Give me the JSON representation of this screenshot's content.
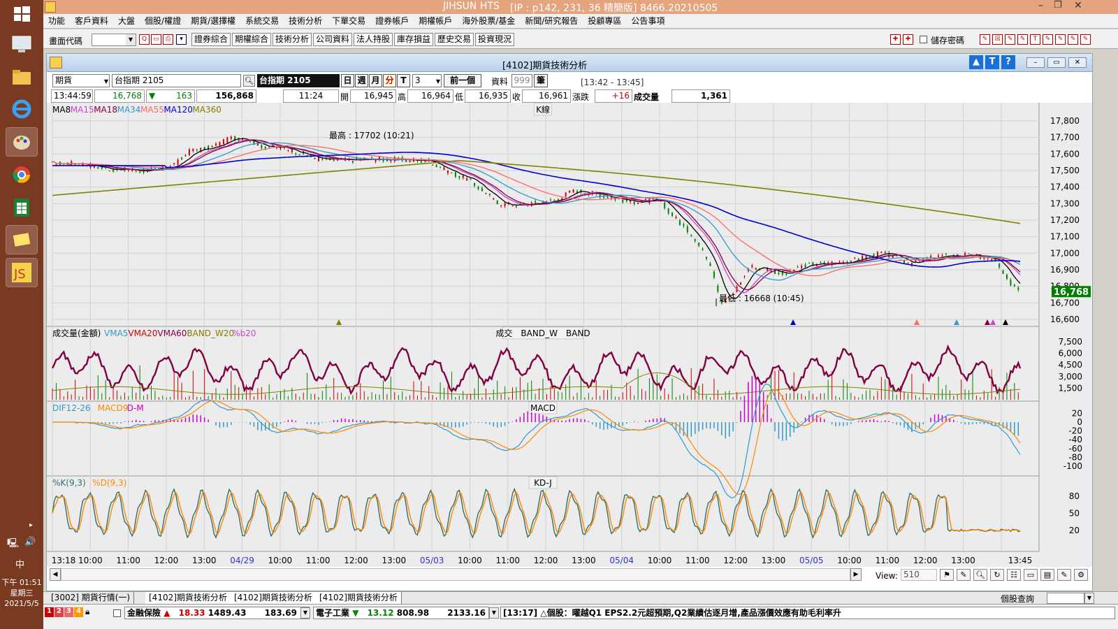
{
  "taskbar": {
    "time": "下午 01:51",
    "weekday": "星期三",
    "date": "2021/5/5",
    "ime": "中"
  },
  "app": {
    "title": "JIHSUN HTS",
    "subtitle": "[IP : p142, 231, 36 精簡版] 8466.20210505"
  },
  "menu": [
    "功能",
    "客戶資料",
    "大盤",
    "個股/權證",
    "期貨/選擇權",
    "系統交易",
    "技術分析",
    "下單交易",
    "證券帳戶",
    "期權帳戶",
    "海外股票/基金",
    "新聞/研究報告",
    "投顧專區",
    "公告事項"
  ],
  "toolbar": {
    "code_label": "畫面代碼",
    "buttons": [
      "證券綜合",
      "期權綜合",
      "技術分析",
      "公司資料",
      "法人持股",
      "庫存損益",
      "歷史交易",
      "投資現況"
    ],
    "save_pwd": "儲存密碼"
  },
  "window": {
    "title": "[4102]期貨技術分析",
    "category": "期貨",
    "contract": "台指期 2105",
    "contract_display": "台指期 2105",
    "periods": [
      "日",
      "週",
      "月",
      "分",
      "T"
    ],
    "minutes": "3",
    "prev_btn": "前一個",
    "data_label": "資料",
    "data_count": "999",
    "data_unit": "筆",
    "time_range": "[13:42 - 13:45]"
  },
  "quote": {
    "time": "13:44:59",
    "price": "16,768",
    "change": "163",
    "volume_total": "156,868",
    "bar_time": "11:24",
    "open_label": "開",
    "open": "16,945",
    "high_label": "高",
    "high": "16,964",
    "low_label": "低",
    "low": "16,935",
    "close_label": "收",
    "close": "16,961",
    "chg_label": "漲跌",
    "chg": "+16",
    "vol_label": "成交量",
    "vol": "1,361"
  },
  "panels": {
    "k": {
      "title": "K線",
      "legend": [
        {
          "name": "MA8",
          "color": "#000000"
        },
        {
          "name": "MA15",
          "color": "#cc44cc"
        },
        {
          "name": "MA18",
          "color": "#800040"
        },
        {
          "name": "MA34",
          "color": "#3399cc"
        },
        {
          "name": "MA55",
          "color": "#ff6666"
        },
        {
          "name": "MA120",
          "color": "#0000cc"
        },
        {
          "name": "MA360",
          "color": "#808000"
        }
      ],
      "high_note": "最高 : 17702 (10:21)",
      "low_note": "最低 : 16668 (10:45)",
      "y_ticks": [
        "17,800",
        "17,700",
        "17,600",
        "17,500",
        "17,400",
        "17,300",
        "17,200",
        "17,100",
        "17,000",
        "16,900",
        "16,800",
        "16,700",
        "16,600"
      ],
      "last_price": "16,768"
    },
    "vol": {
      "title": "成交　BAND_W　BAND",
      "legend": [
        {
          "name": "成交量(金額)",
          "color": "#000000"
        },
        {
          "name": "VMA5",
          "color": "#3399cc"
        },
        {
          "name": "VMA20",
          "color": "#cc0000"
        },
        {
          "name": "VMA60",
          "color": "#800040"
        },
        {
          "name": "BAND_W20",
          "color": "#808000"
        },
        {
          "name": "%b20",
          "color": "#cc44cc"
        }
      ],
      "y_ticks": [
        "7,500",
        "6,000",
        "4,500",
        "3,000",
        "1,500"
      ]
    },
    "macd": {
      "title": "MACD",
      "legend": [
        {
          "name": "DIF12-26",
          "color": "#3399cc"
        },
        {
          "name": "MACD9",
          "color": "#ff8800"
        },
        {
          "name": "D-M",
          "color": "#cc00cc"
        }
      ],
      "y_ticks": [
        "20",
        "0",
        "-20",
        "-40",
        "-60",
        "-80",
        "-100"
      ]
    },
    "kd": {
      "title": "KD-J",
      "legend": [
        {
          "name": "%K(9,3)",
          "color": "#2f7070"
        },
        {
          "name": "%D(9,3)",
          "color": "#ff8800"
        }
      ],
      "y_ticks": [
        "80",
        "50",
        "20"
      ]
    }
  },
  "x_ticks": [
    {
      "label": "13:18",
      "date": false
    },
    {
      "label": "10:00",
      "date": false
    },
    {
      "label": "11:00",
      "date": false
    },
    {
      "label": "12:00",
      "date": false
    },
    {
      "label": "13:00",
      "date": false
    },
    {
      "label": "04/29",
      "date": true
    },
    {
      "label": "10:00",
      "date": false
    },
    {
      "label": "11:00",
      "date": false
    },
    {
      "label": "12:00",
      "date": false
    },
    {
      "label": "13:00",
      "date": false
    },
    {
      "label": "05/03",
      "date": true
    },
    {
      "label": "10:00",
      "date": false
    },
    {
      "label": "11:00",
      "date": false
    },
    {
      "label": "12:00",
      "date": false
    },
    {
      "label": "13:00",
      "date": false
    },
    {
      "label": "05/04",
      "date": true
    },
    {
      "label": "10:00",
      "date": false
    },
    {
      "label": "11:00",
      "date": false
    },
    {
      "label": "12:00",
      "date": false
    },
    {
      "label": "13:00",
      "date": false
    },
    {
      "label": "05/05",
      "date": true
    },
    {
      "label": "10:00",
      "date": false
    },
    {
      "label": "11:00",
      "date": false
    },
    {
      "label": "12:00",
      "date": false
    },
    {
      "label": "13:00",
      "date": false
    },
    {
      "label": "13:45",
      "date": false
    }
  ],
  "view": {
    "label": "View:",
    "value": "510"
  },
  "tabs": [
    "[3002] 期貨行情(一)",
    "[4102]期貨技術分析",
    "[4102]期貨技術分析",
    "[4102]期貨技術分析"
  ],
  "stock_query": "個股查詢",
  "status": {
    "sector1": "金融保險",
    "s1_change": "18.33",
    "s1_index": "1489.43",
    "s1_vol": "183.69",
    "sector2": "電子工業",
    "s2_change": "13.12",
    "s2_index": "808.98",
    "s2_vol": "2133.16",
    "news": "[13:17] △個股：曜越Q1 EPS2.2元超預期,Q2業績估逐月增,產品漲價效應有助毛利率升"
  },
  "colors": {
    "titlebar": "#e3a47e",
    "taskbar": "#7a3a22",
    "up": "#cc0000",
    "down": "#008000",
    "price_bg": "#008000"
  }
}
